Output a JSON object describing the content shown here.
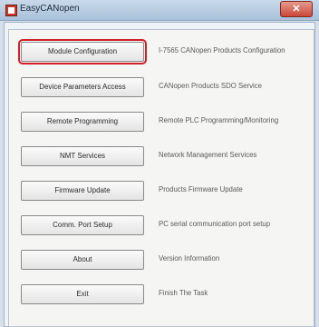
{
  "window": {
    "title": "EasyCANopen",
    "close_label": "✕"
  },
  "items": [
    {
      "label": "Module Configuration",
      "desc": "I-7565 CANopen Products Configuration",
      "selected": true
    },
    {
      "label": "Device Parameters Access",
      "desc": "CANopen Products SDO Service"
    },
    {
      "label": "Remote Programming",
      "desc": "Remote PLC Programming/Monitoring"
    },
    {
      "label": "NMT Services",
      "desc": "Network Management Services"
    },
    {
      "label": "Firmware Update",
      "desc": "Products Firmware Update"
    },
    {
      "label": "Comm. Port Setup",
      "desc": "PC serial communication port setup"
    },
    {
      "label": "About",
      "desc": "Version Information"
    },
    {
      "label": "Exit",
      "desc": "Finish The Task"
    }
  ]
}
